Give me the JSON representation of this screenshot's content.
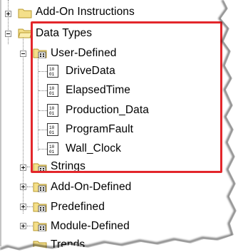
{
  "tree": {
    "items": [
      {
        "label": "Add-On Instructions",
        "icon": "folder-icon",
        "expander": "plus"
      },
      {
        "label": "Data Types",
        "icon": "folder-open-icon",
        "expander": "minus"
      },
      {
        "label": "User-Defined",
        "icon": "typed-folder-icon",
        "expander": "minus"
      },
      {
        "label": "DriveData",
        "icon": "data-type-icon"
      },
      {
        "label": "ElapsedTime",
        "icon": "data-type-icon"
      },
      {
        "label": "Production_Data",
        "icon": "data-type-icon"
      },
      {
        "label": "ProgramFault",
        "icon": "data-type-icon"
      },
      {
        "label": "Wall_Clock",
        "icon": "data-type-icon"
      },
      {
        "label": "Strings",
        "icon": "typed-folder-icon",
        "expander": "plus"
      },
      {
        "label": "Add-On-Defined",
        "icon": "typed-folder-icon",
        "expander": "plus"
      },
      {
        "label": "Predefined",
        "icon": "typed-folder-icon",
        "expander": "plus"
      },
      {
        "label": "Module-Defined",
        "icon": "typed-folder-icon",
        "expander": "plus"
      },
      {
        "label": "Trends",
        "icon": "folder-icon"
      }
    ]
  },
  "colors": {
    "highlight_border": "#e3262b",
    "folder_fill": "#f4df8a",
    "folder_stroke": "#b99a2e",
    "tree_lines": "#808080"
  }
}
